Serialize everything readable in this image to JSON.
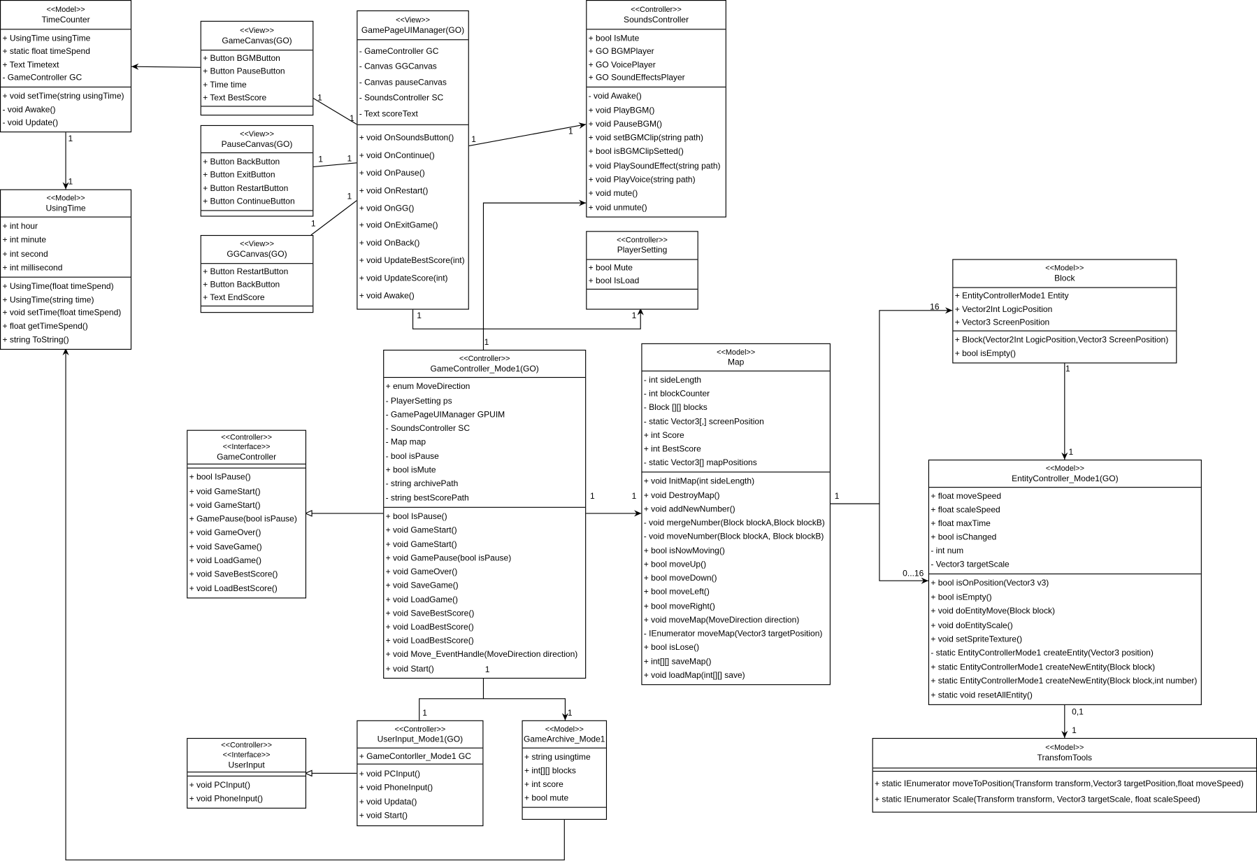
{
  "classes": [
    {
      "id": "timecounter",
      "stereotypes": [
        "<<Model>>"
      ],
      "name": "TimeCounter",
      "attributes": [
        "+ UsingTime usingTime",
        "+ static float timeSpend",
        "+ Text Timetext",
        "- GameController GC"
      ],
      "methods": [
        "+ void setTime(string usingTime)",
        "- void Awake()",
        "- void Update()"
      ]
    },
    {
      "id": "usingtime",
      "stereotypes": [
        "<<Model>>"
      ],
      "name": "UsingTime",
      "attributes": [
        "+ int hour",
        "+ int minute",
        "+ int second",
        "+ int millisecond"
      ],
      "methods": [
        "+ UsingTime(float timeSpend)",
        "+ UsingTime(string time)",
        "+ void setTime(float timeSpend)",
        "+ float getTimeSpend()",
        "+ string ToString()"
      ]
    },
    {
      "id": "gamecanvas",
      "stereotypes": [
        "<<View>>"
      ],
      "name": "GameCanvas(GO)",
      "attributes": [
        "+ Button BGMButton",
        "+ Button PauseButton",
        "+ Time time",
        "+ Text BestScore"
      ],
      "methods": []
    },
    {
      "id": "pausecanvas",
      "stereotypes": [
        "<<View>>"
      ],
      "name": "PauseCanvas(GO)",
      "attributes": [
        "+ Button BackButton",
        "+ Button ExitButton",
        "+ Button RestartButton",
        "+ Button ContinueButton"
      ],
      "methods": []
    },
    {
      "id": "ggcanvas",
      "stereotypes": [
        "<<View>>"
      ],
      "name": "GGCanvas(GO)",
      "attributes": [
        "+ Button RestartButton",
        "+ Button BackButton",
        "+ Text EndScore"
      ],
      "methods": []
    },
    {
      "id": "gpuim",
      "stereotypes": [
        "<<View>>"
      ],
      "name": "GamePageUIManager(GO)",
      "attributes": [
        "- GameController GC",
        "- Canvas GGCanvas",
        "- Canvas pauseCanvas",
        "- SoundsController SC",
        "- Text scoreText"
      ],
      "methods": [
        "+ void OnSoundsButton()",
        "+ void OnContinue()",
        "+ void OnPause()",
        "+ void OnRestart()",
        "+ void OnGG()",
        "+ void OnExitGame()",
        "+ void OnBack()",
        "+ void UpdateBestScore(int)",
        "+ void UpdateScore(int)",
        "+ void Awake()"
      ]
    },
    {
      "id": "soundscontroller",
      "stereotypes": [
        "<<Controller>>"
      ],
      "name": "SoundsController",
      "attributes": [
        "+ bool IsMute",
        "+ GO BGMPlayer",
        "+ GO VoicePlayer",
        "+ GO SoundEffectsPlayer"
      ],
      "methods": [
        "- void Awake()",
        "+ void PlayBGM()",
        "+ void PauseBGM()",
        "+ void setBGMClip(string path)",
        "+ bool isBGMClipSetted()",
        "+ void PlaySoundEffect(string path)",
        "+ void PlayVoice(string path)",
        "+ void mute()",
        "+ void unmute()"
      ]
    },
    {
      "id": "playersetting",
      "stereotypes": [
        "<<Controller>>"
      ],
      "name": "PlayerSetting",
      "attributes": [
        "+ bool Mute",
        "+ bool IsLoad"
      ],
      "methods": []
    },
    {
      "id": "gamecontroller_mode1",
      "stereotypes": [
        "<<Controller>>"
      ],
      "name": "GameController_Mode1(GO)",
      "attributes": [
        "+ enum MoveDirection",
        "- PlayerSetting ps",
        "- GamePageUIManager GPUIM",
        "- SoundsController SC",
        "- Map map",
        "- bool isPause",
        "+ bool isMute",
        "- string archivePath",
        "- string bestScorePath"
      ],
      "methods": [
        "+ bool IsPause()",
        "+ void GameStart()",
        "+ void GameStart()",
        "+ void GamePause(bool isPause)",
        "+ void GameOver()",
        "+ void SaveGame()",
        "+ void LoadGame()",
        "+ void SaveBestScore()",
        "+ void LoadBestScore()",
        "+ void LoadBestScore()",
        "+ void Move_EventHandle(MoveDirection direction)",
        "+ void Start()"
      ]
    },
    {
      "id": "map",
      "stereotypes": [
        "<<Model>>"
      ],
      "name": "Map",
      "attributes": [
        "- int sideLength",
        "- int blockCounter",
        "- Block [][] blocks",
        "- static Vector3[,] screenPosition",
        "+ int Score",
        "+ int BestScore",
        "- static Vector3[] mapPositions"
      ],
      "methods": [
        "+ void InitMap(int sideLength)",
        "+ void DestroyMap()",
        "+ void addNewNumber()",
        "- void mergeNumber(Block blockA,Block blockB)",
        "- void moveNumber(Block blockA, Block blockB)",
        "+  bool isNowMoving()",
        "+ bool moveUp()",
        "+ bool moveDown()",
        "+ bool moveLeft()",
        "+ bool moveRight()",
        "+ void moveMap(MoveDirection direction)",
        "- IEnumerator moveMap(Vector3 targetPosition)",
        "+ bool isLose()",
        "+ int[][] saveMap()",
        "+ void loadMap(int[][] save)"
      ]
    },
    {
      "id": "block",
      "stereotypes": [
        "<<Model>>"
      ],
      "name": "Block",
      "attributes": [
        "+ EntityControllerMode1 Entity",
        "+ Vector2Int LogicPosition",
        "+ Vector3 ScreenPosition"
      ],
      "methods": [
        "+ Block(Vector2Int LogicPosition,Vector3 ScreenPosition)",
        "+ bool isEmpty()"
      ]
    },
    {
      "id": "entitycontroller",
      "stereotypes": [
        "<<Model>>"
      ],
      "name": "EntityController_Mode1(GO)",
      "attributes": [
        "+ float moveSpeed",
        "+ float scaleSpeed",
        "+ float maxTime",
        "+ bool isChanged",
        "- int num",
        "- Vector3 targetScale"
      ],
      "methods": [
        "+ bool isOnPosition(Vector3 v3)",
        "+ bool isEmpty()",
        "+ void doEntityMove(Block block)",
        "+ void doEntityScale()",
        "+ void setSpriteTexture()",
        "- static EntityControllerMode1 createEntity(Vector3 position)",
        "+ static EntityControllerMode1 createNewEntity(Block block)",
        "+ static EntityControllerMode1 createNewEntity(Block block,int number)",
        "+ static void resetAllEntity()"
      ]
    },
    {
      "id": "transformtools",
      "stereotypes": [
        "<<Model>>"
      ],
      "name": "TransfomTools",
      "attributes": [],
      "methods": [
        "+ static IEnumerator moveToPosition(Transform transform,Vector3 targetPosition,float moveSpeed)",
        "+ static IEnumerator Scale(Transform transform, Vector3 targetScale, float scaleSpeed)"
      ]
    },
    {
      "id": "gamecontroller_iface",
      "stereotypes": [
        "<<Controller>>",
        "<<Interface>>"
      ],
      "name": "GameController",
      "attributes": [],
      "methods": [
        "+ bool IsPause()",
        "+ void GameStart()",
        "+ void GameStart()",
        "+ GamePause(bool isPause)",
        "+ void GameOver()",
        "+ void SaveGame()",
        "+ void LoadGame()",
        "+ void SaveBestScore()",
        "+ void LoadBestScore()"
      ]
    },
    {
      "id": "userinput_mode1",
      "stereotypes": [
        "<<Controller>>"
      ],
      "name": "UserInput_Mode1(GO)",
      "attributes": [
        "+ GameContorller_Mode1 GC"
      ],
      "methods": [
        "+ void PCInput()",
        "+ void PhoneInput()",
        "+ void Updata()",
        "+ void Start()"
      ]
    },
    {
      "id": "gamearchive",
      "stereotypes": [
        "<<Model>>"
      ],
      "name": "GameArchive_Mode1",
      "attributes": [
        "+ string usingtime",
        "+ int[][] blocks",
        "+ int score",
        "+ bool mute"
      ],
      "methods": []
    },
    {
      "id": "userinput_iface",
      "stereotypes": [
        "<<Controller>>",
        "<<Interface>>"
      ],
      "name": "UserInput",
      "attributes": [],
      "methods": [
        "+ void PCInput()",
        "+ void PhoneInput()"
      ]
    }
  ],
  "multiplicities": [
    "1",
    "1",
    "1",
    "1",
    "1",
    "1",
    "1",
    "1",
    "1",
    "1",
    "1",
    "1",
    "1",
    "1",
    "1",
    "1",
    "1",
    "1",
    "1",
    "1",
    "16",
    "0...16",
    "1",
    "1",
    "0,1",
    "1",
    "1"
  ]
}
